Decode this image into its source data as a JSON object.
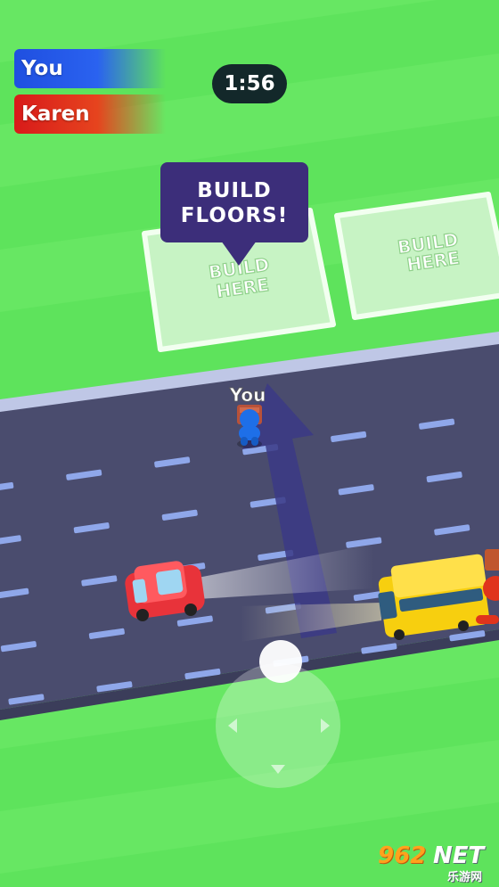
{
  "hud": {
    "players": [
      {
        "name": "You",
        "color": "#2a62f0"
      },
      {
        "name": "Karen",
        "color": "#e0341c"
      }
    ],
    "timer": "1:56"
  },
  "callout": {
    "line1": "BUILD",
    "line2": "FLOORS!"
  },
  "plots": [
    {
      "label_line1": "BUILD",
      "label_line2": "HERE"
    },
    {
      "label_line1": "BUILD",
      "label_line2": "HERE"
    }
  ],
  "player_tag": "You",
  "watermark": {
    "brand": "962",
    "suffix": "NET",
    "subtitle": "乐游网"
  },
  "colors": {
    "grass": "#5ee35c",
    "grass_stripe": "#6fe86a",
    "road": "#4a4c6e",
    "lane_marking": "#9fb4f0",
    "arrow": "#3b3a86",
    "car": "#e8333a",
    "bus": "#f7cf0f"
  },
  "icons": [
    "player-character-icon",
    "red-car-icon",
    "school-bus-icon",
    "direction-arrow-icon",
    "joystick-icon"
  ]
}
